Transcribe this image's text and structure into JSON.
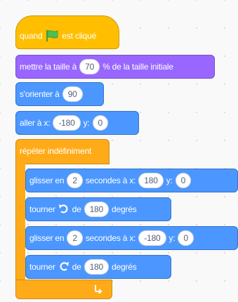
{
  "script": {
    "hat": {
      "label": "quand",
      "icon": "green-flag-icon",
      "suffix": "est cliqué"
    },
    "set_size": {
      "label": "mettre la taille à",
      "value": "70",
      "suffix": "% de la taille initiale"
    },
    "point_direction": {
      "label": "s'orienter à",
      "value": "90"
    },
    "goto_xy": {
      "label": "aller à x:",
      "x_value": "-180",
      "y_label": "y:",
      "y_value": "0"
    },
    "forever": {
      "label": "répéter indéfiniment",
      "icon": "loop-arrow-icon"
    },
    "inner": [
      {
        "kind": "glide",
        "label": "glisser en",
        "secs": "2",
        "mid": "secondes à x:",
        "x": "180",
        "y_label": "y:",
        "y": "0"
      },
      {
        "kind": "turn",
        "label": "tourner",
        "icon": "rotate-left-icon",
        "de": "de",
        "value": "180",
        "suffix": "degrés"
      },
      {
        "kind": "glide",
        "label": "glisser en",
        "secs": "2",
        "mid": "secondes à x:",
        "x": "-180",
        "y_label": "y:",
        "y": "0"
      },
      {
        "kind": "turn",
        "label": "tourner",
        "icon": "rotate-right-icon",
        "de": "de",
        "value": "180",
        "suffix": "degrés"
      }
    ]
  },
  "colors": {
    "events": "#ffbf00",
    "looks": "#9966ff",
    "motion": "#4c97ff",
    "control": "#ffab19",
    "flag": "#4cbf56",
    "workspace": "#f9f9f9"
  }
}
